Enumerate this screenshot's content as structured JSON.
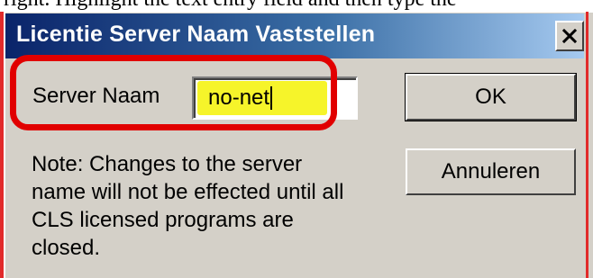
{
  "context_text": "right. Highlight the text entry field and then type the",
  "window": {
    "title": "Licentie Server Naam Vaststellen",
    "close_icon": "close-icon",
    "close_glyph": "×"
  },
  "form": {
    "server_label": "Server Naam",
    "server_value": "no-net",
    "note": "Note: Changes to the server name will not be effected until all CLS licensed programs are closed."
  },
  "buttons": {
    "ok_label": "OK",
    "cancel_label": "Annuleren"
  },
  "colors": {
    "annotation_red": "#e10000",
    "input_highlight": "#f6f42a",
    "titlebar_start": "#0a246a",
    "titlebar_end": "#a6caf0",
    "dialog_face": "#d4d0c8"
  }
}
